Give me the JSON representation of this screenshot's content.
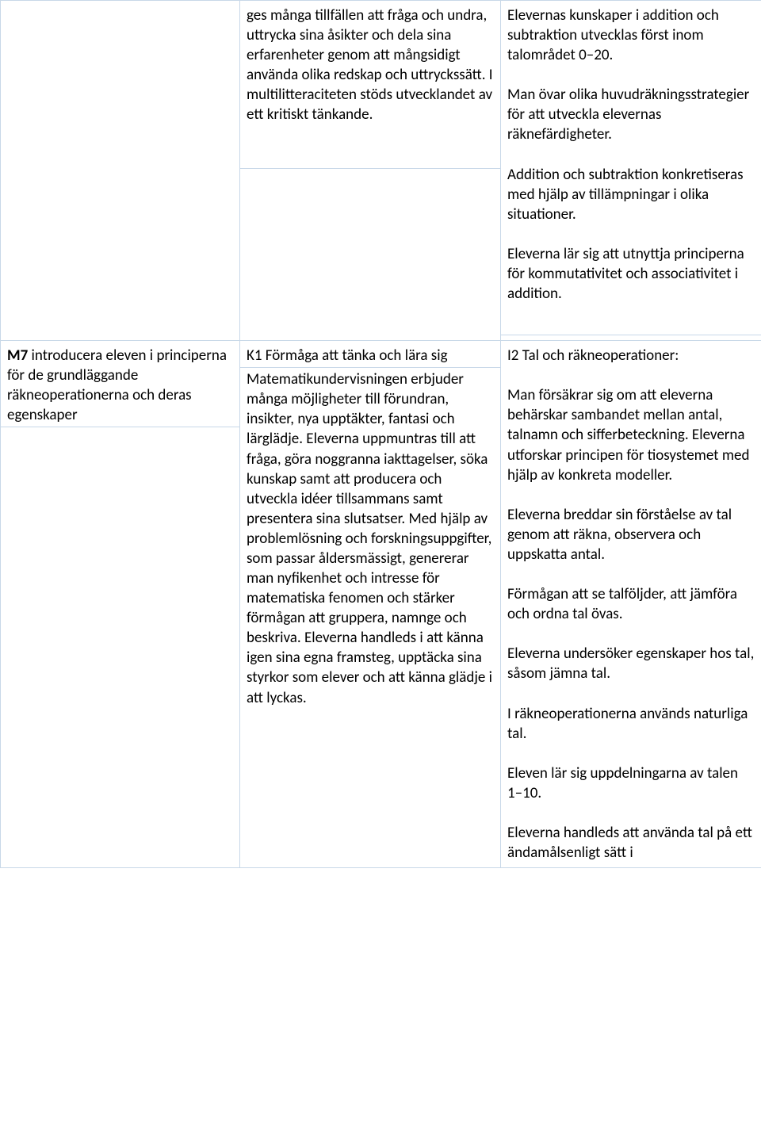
{
  "rows": [
    {
      "c1": {
        "lead": "",
        "body": ""
      },
      "c2": {
        "lead": "ges många tillfällen att fråga och undra, uttrycka sina åsikter och dela sina erfarenheter genom att mångsidigt använda olika redskap och uttryckssätt. I multilitteraciteten stöds utvecklandet av ett kritiskt tänkande.",
        "body": ""
      },
      "c3": {
        "lead": "",
        "body": "Elevernas kunskaper i addition och subtraktion utvecklas först inom talområdet 0–20.\n\nMan övar olika huvudräkningsstrategier för att utveckla elevernas räknefärdigheter.\n\nAddition och subtraktion konkretiseras med hjälp av tillämpningar i olika situationer.\n\nEleverna lär sig att utnyttja principerna för kommutativitet och associativitet i addition."
      }
    },
    {
      "c1": {
        "lead_bold": "M7",
        "lead": " introducera eleven i principerna för de grundläggande räkneoperationerna och deras egenskaper",
        "body": ""
      },
      "c2": {
        "lead": "K1 Förmåga att tänka och lära sig",
        "body": "Matematikundervisningen erbjuder många möjligheter till förundran, insikter, nya upptäkter, fantasi och lärglädje. Eleverna uppmuntras till att fråga, göra noggranna iakttagelser, söka kunskap samt att producera och utveckla idéer tillsammans samt presentera sina slutsatser. Med hjälp av problemlösning och forskningsuppgifter, som passar åldersmässigt, genererar man nyfikenhet och intresse för matematiska fenomen och stärker förmågan att gruppera, namnge och beskriva. Eleverna handleds i att känna igen sina egna framsteg, upptäcka sina styrkor som elever och att känna glädje i att lyckas."
      },
      "c3": {
        "lead": "",
        "body": "I2 Tal och räkneoperationer:\n\nMan försäkrar sig om att eleverna behärskar sambandet mellan antal, talnamn och sifferbeteckning. Eleverna utforskar principen för tiosystemet med hjälp av konkreta modeller.\n\nEleverna breddar sin förståelse av tal genom att räkna, observera och uppskatta antal.\n\nFörmågan att se talföljder, att jämföra och ordna tal övas.\n\nEleverna undersöker egenskaper hos tal, såsom jämna tal.\n\nI räkneoperationerna används naturliga tal.\n\nEleven lär sig uppdelningarna av talen 1–10.\n\nEleverna handleds att använda tal på ett ändamålsenligt sätt i"
      }
    }
  ]
}
